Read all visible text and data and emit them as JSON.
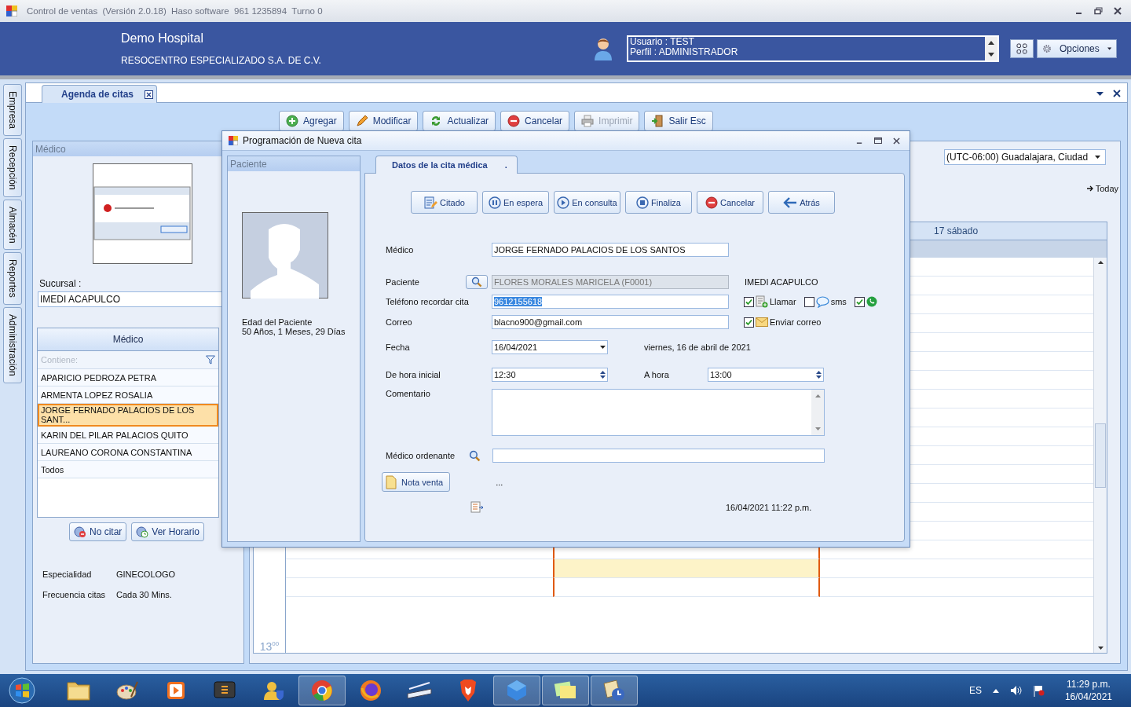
{
  "window": {
    "title": "Control de ventas  (Versión 2.0.18)  Haso software  961 1235894  Turno 0"
  },
  "header": {
    "company": "Demo Hospital",
    "subtitle": "RESOCENTRO ESPECIALIZADO S.A. DE C.V.",
    "user_lines": [
      "Usuario : TEST",
      "Perfil : ADMINISTRADOR"
    ],
    "options_button": "Opciones"
  },
  "side_tabs": [
    "Empresa",
    "Recepción",
    "Almacén",
    "Reportes",
    "Administración"
  ],
  "document_tab": "Agenda de citas",
  "toolbar": [
    {
      "kind": "add",
      "label": "Agregar",
      "disabled": false
    },
    {
      "kind": "edit",
      "label": "Modificar",
      "disabled": false
    },
    {
      "kind": "refresh",
      "label": "Actualizar",
      "disabled": false
    },
    {
      "kind": "cancel",
      "label": "Cancelar",
      "disabled": false
    },
    {
      "kind": "print",
      "label": "Imprimir",
      "disabled": true
    },
    {
      "kind": "exit",
      "label": "Salir  Esc",
      "disabled": false
    }
  ],
  "doctor_panel": {
    "title": "Médico",
    "branch_label": "Sucursal :",
    "branch": "IMEDI ACAPULCO",
    "list_header": "Médico",
    "filter_placeholder": "Contiene:",
    "doctors": [
      {
        "name": "APARICIO PEDROZA PETRA",
        "selected": false
      },
      {
        "name": "ARMENTA LOPEZ ROSALIA",
        "selected": false
      },
      {
        "name": "JORGE FERNADO PALACIOS DE LOS SANT...",
        "selected": true
      },
      {
        "name": "KARIN DEL PILAR PALACIOS QUITO",
        "selected": false
      },
      {
        "name": "LAUREANO CORONA CONSTANTINA",
        "selected": false
      },
      {
        "name": "Todos",
        "selected": false
      }
    ],
    "buttons": [
      {
        "kind": "no-cite",
        "label": "No citar"
      },
      {
        "kind": "schedule",
        "label": "Ver  Horario"
      }
    ],
    "details": [
      {
        "label": "Especialidad",
        "value": "GINECOLOGO"
      },
      {
        "label": "Frecuencia citas",
        "value": "Cada 30 Mins."
      }
    ]
  },
  "calendar": {
    "timezone": "(UTC-06:00) Guadalajara, Ciudad",
    "today": "Today",
    "day_header": "17 sábado",
    "hour": "13",
    "minutes": "00"
  },
  "dialog": {
    "title": "Programación de Nueva cita",
    "patient_panel": {
      "title": "Paciente",
      "age_label": "Edad del Paciente",
      "age": "50 Años, 1 Meses, 29 Días"
    },
    "tab": "Datos de la cita médica",
    "tab_mark": ".",
    "actions": [
      {
        "kind": "cited",
        "label": "Citado"
      },
      {
        "kind": "pause",
        "label": "En espera"
      },
      {
        "kind": "play",
        "label": "En consulta"
      },
      {
        "kind": "stop",
        "label": "Finaliza"
      },
      {
        "kind": "cancel",
        "label": "Cancelar"
      },
      {
        "kind": "back",
        "label": "Atrás"
      }
    ],
    "doctor": {
      "label": "Médico",
      "value": "JORGE FERNADO PALACIOS DE LOS SANTOS"
    },
    "patient": {
      "label": "Paciente",
      "value": "FLORES MORALES MARICELA (F0001)",
      "disabled": true
    },
    "branch": "IMEDI ACAPULCO",
    "phone": {
      "label": "Teléfono recordar cita",
      "value": "9612155618",
      "text_selected": true
    },
    "reminders": [
      {
        "kind": "call",
        "label": "Llamar",
        "checked": true
      },
      {
        "kind": "sms",
        "label": "sms",
        "checked": false
      },
      {
        "kind": "whatsapp",
        "checked": true
      }
    ],
    "email": {
      "label": "Correo",
      "value": "blacno900@gmail.com"
    },
    "send_email": {
      "label": "Enviar correo",
      "checked": true
    },
    "date": {
      "label": "Fecha",
      "value": "16/04/2021",
      "long": "viernes, 16 de abril de 2021"
    },
    "start": {
      "label": "De hora inicial",
      "value": "12:30"
    },
    "end": {
      "label": "A hora",
      "value": "13:00"
    },
    "comment": {
      "label": "Comentario"
    },
    "ordering_doctor": {
      "label": "Médico ordenante"
    },
    "note_button": "Nota venta",
    "ellipsis": "...",
    "timestamp": "16/04/2021 11:22 p.m."
  },
  "taskbar": {
    "apps": [
      {
        "kind": "folder",
        "active": false
      },
      {
        "kind": "paint",
        "active": false
      },
      {
        "kind": "media",
        "active": false
      },
      {
        "kind": "editor",
        "active": false
      },
      {
        "kind": "user",
        "active": false
      },
      {
        "kind": "chrome",
        "active": true
      },
      {
        "kind": "firefox",
        "active": false
      },
      {
        "kind": "scanner",
        "active": false
      },
      {
        "kind": "brave",
        "active": false
      },
      {
        "kind": "cube",
        "active": true
      },
      {
        "kind": "notes",
        "active": true
      },
      {
        "kind": "app",
        "active": true
      }
    ],
    "language": "ES",
    "time": "11:29 p.m.",
    "date": "16/04/2021"
  }
}
